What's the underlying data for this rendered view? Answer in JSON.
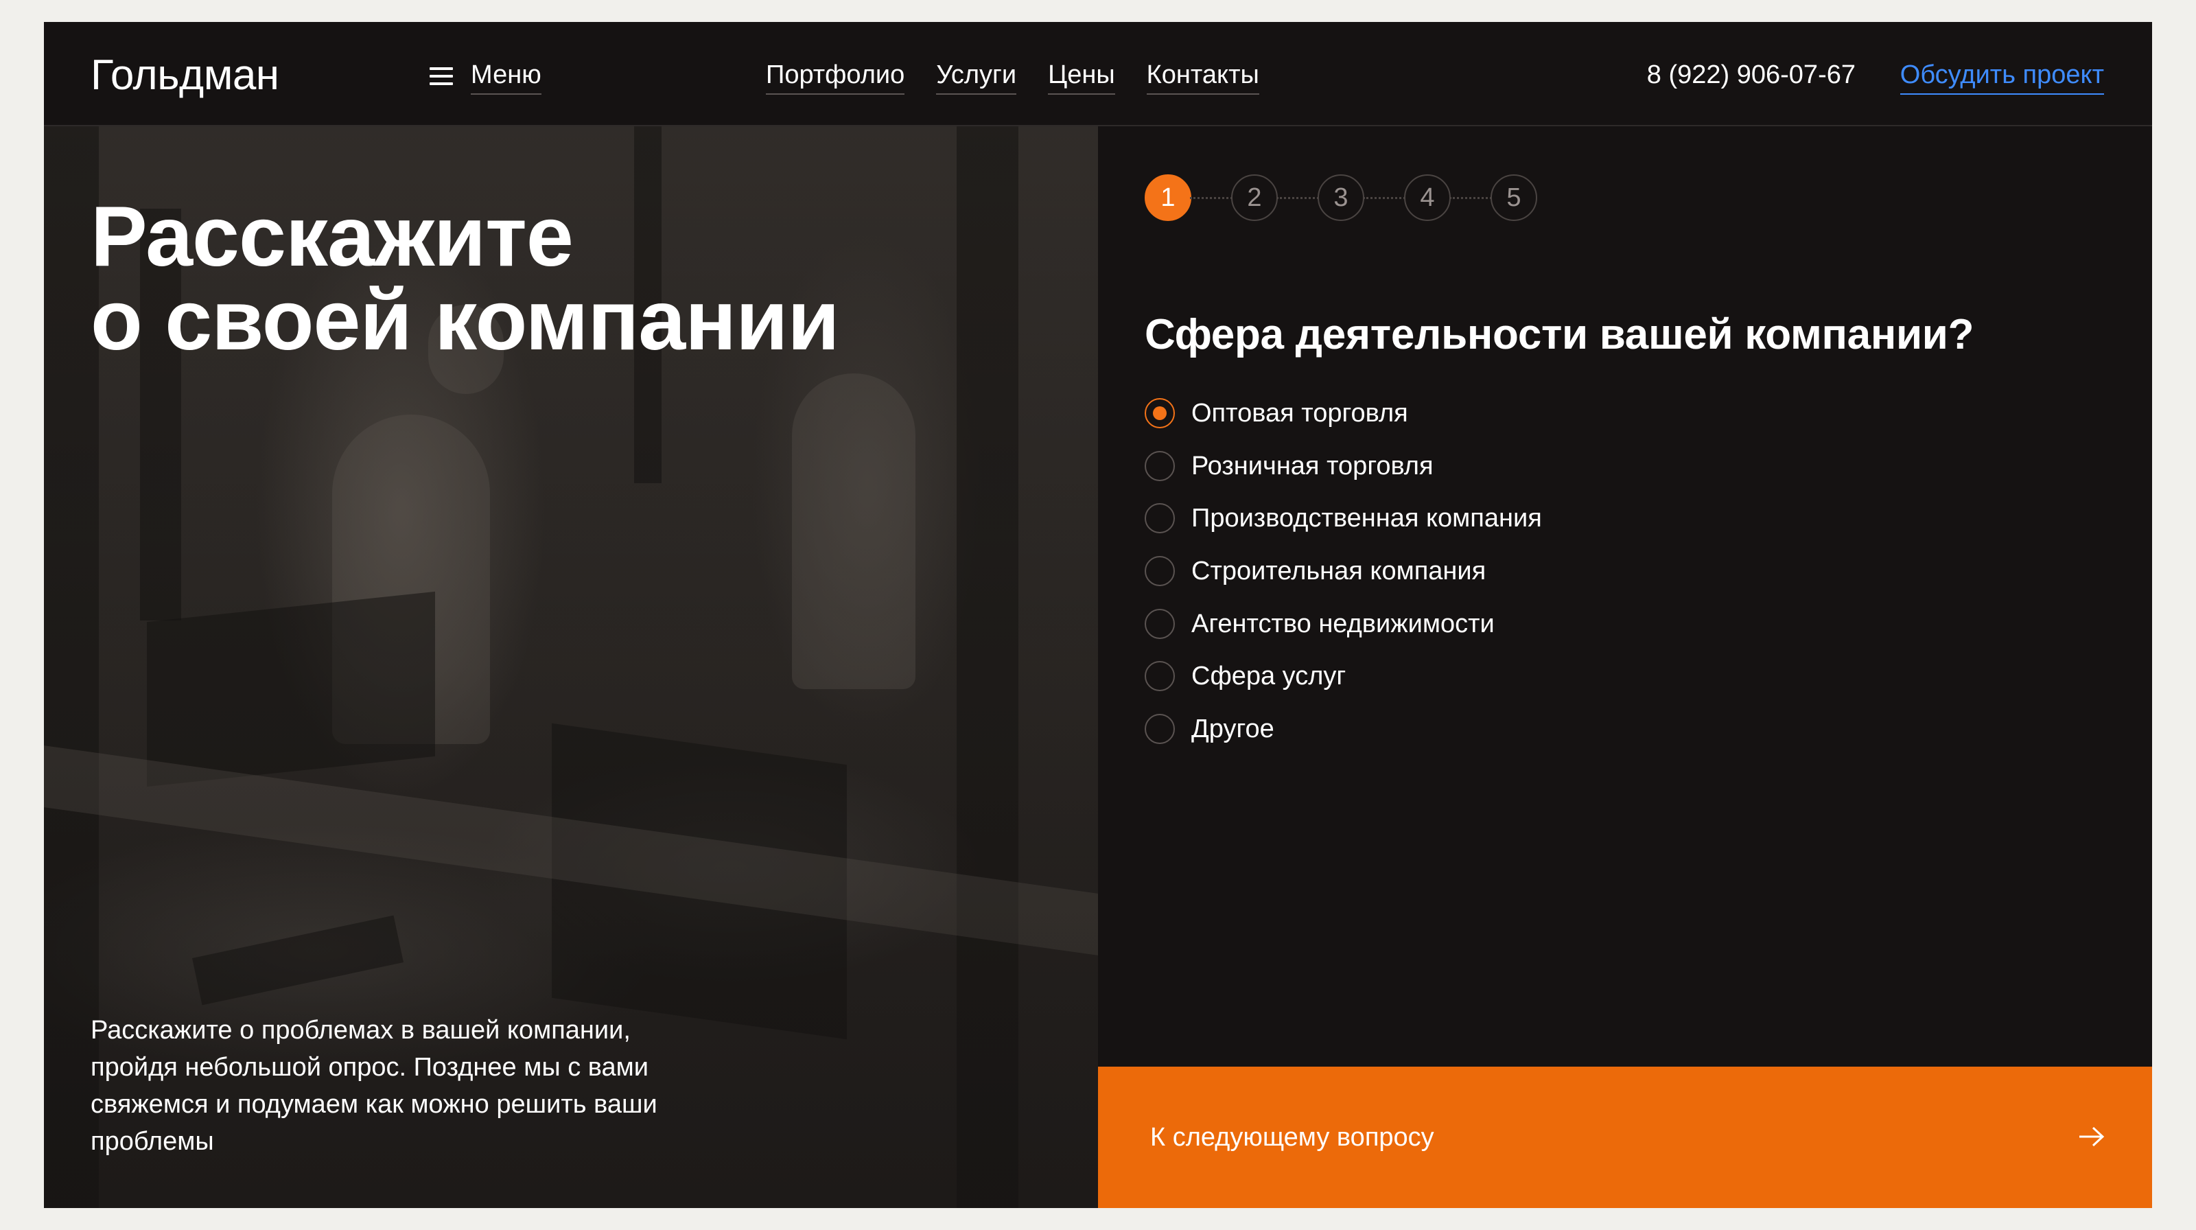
{
  "header": {
    "logo": "Гольдман",
    "menu_label": "Меню",
    "nav": [
      "Портфолио",
      "Услуги",
      "Цены",
      "Контакты"
    ],
    "phone": "8 (922) 906-07-67",
    "cta": "Обсудить проект"
  },
  "hero": {
    "title_line1": "Расскажите",
    "title_line2": "о своей компании",
    "description": "Расскажите о проблемах в вашей компании, пройдя небольшой опрос. Позднее мы с вами свяжемся и подумаем как можно решить ваши проблемы"
  },
  "form": {
    "steps": [
      "1",
      "2",
      "3",
      "4",
      "5"
    ],
    "active_step": 1,
    "question": "Сфера деятельности вашей компании?",
    "options": [
      "Оптовая торговля",
      "Розничная торговля",
      "Производственная компания",
      "Строительная компания",
      "Агентство недвижимости",
      "Сфера услуг",
      "Другое"
    ],
    "selected_option": "Оптовая торговля",
    "next_label": "К следующему вопросу"
  },
  "colors": {
    "accent": "#f47318",
    "button": "#ec6a0a",
    "link": "#3f8cff",
    "background": "#151212"
  },
  "icons": [
    "hamburger-icon",
    "arrow-right-icon"
  ]
}
